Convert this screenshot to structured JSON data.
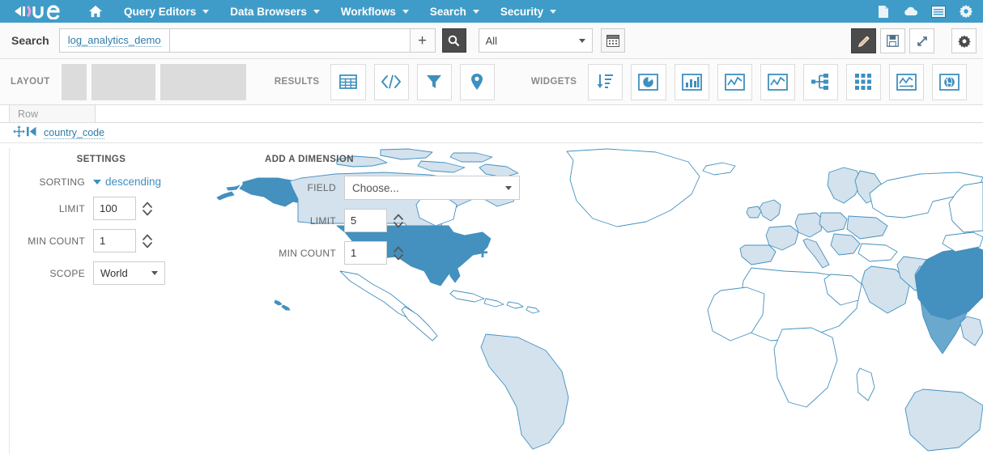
{
  "navbar": {
    "brand": "HUE",
    "home_icon": "home-icon",
    "items": [
      {
        "label": "Query Editors",
        "caret": true
      },
      {
        "label": "Data Browsers",
        "caret": true
      },
      {
        "label": "Workflows",
        "caret": true
      },
      {
        "label": "Search",
        "caret": true
      },
      {
        "label": "Security",
        "caret": true
      }
    ],
    "right_icons": [
      "document-icon",
      "cloud-icon",
      "list-icon",
      "gear-icon"
    ]
  },
  "search": {
    "label": "Search",
    "collection_chip": "log_analytics_demo",
    "query_value": "",
    "query_placeholder": "",
    "add_label": "+",
    "search_icon": "search-icon",
    "scope_select": "All",
    "calendar_icon": "calendar-icon",
    "toolbar_icons": [
      "edit-pencil-icon",
      "save-floppy-icon",
      "expand-arrows-icon",
      "settings-gear-icon"
    ]
  },
  "builder": {
    "layout_label": "LAYOUT",
    "results_label": "RESULTS",
    "widgets_label": "WIDGETS",
    "results_icons": [
      "grid-table-icon",
      "code-brackets-icon",
      "filter-funnel-icon",
      "map-marker-icon"
    ],
    "widget_icons": [
      "sort-descending-icon",
      "pie-chart-icon",
      "bar-chart-icon",
      "line-chart-icon",
      "tree-hierarchy-icon",
      "grid-squares-icon",
      "timeline-chart-icon",
      "globe-map-icon"
    ]
  },
  "row": {
    "tab_label": "Row",
    "move_icon": "move-arrows-icon",
    "step_icon": "step-backward-icon",
    "field_name": "country_code"
  },
  "settings": {
    "title": "SETTINGS",
    "sorting_label": "SORTING",
    "sorting_value": "descending",
    "limit_label": "LIMIT",
    "limit_value": "100",
    "min_count_label": "MIN COUNT",
    "min_count_value": "1",
    "scope_label": "SCOPE",
    "scope_value": "World"
  },
  "dimension": {
    "title": "ADD A DIMENSION",
    "field_label": "FIELD",
    "field_value": "Choose...",
    "limit_label": "LIMIT",
    "limit_value": "5",
    "min_count_label": "MIN COUNT",
    "min_count_value": "1",
    "add_label": "+"
  },
  "colors": {
    "navbar": "#3f9cc8",
    "accent": "#3f8fbf",
    "map_high": "#4490bf",
    "map_mid": "#6aa8ce",
    "map_low": "#d3e2ed",
    "map_stroke": "#4490bf",
    "toolbar_active": "#4b4b4b"
  },
  "chart_data": {
    "type": "heatmap",
    "title": "country_code",
    "projection": "world-equirectangular",
    "scope": "World",
    "legend_position": "none",
    "regions": [
      {
        "code": "US",
        "name": "United States",
        "level": "high",
        "color": "#4490bf"
      },
      {
        "code": "CN",
        "name": "China",
        "level": "high",
        "color": "#4490bf"
      },
      {
        "code": "IN",
        "name": "India",
        "level": "mid",
        "color": "#6aa8ce"
      },
      {
        "code": "CA",
        "name": "Canada",
        "level": "low",
        "color": "#d3e2ed"
      },
      {
        "code": "GB",
        "name": "United Kingdom",
        "level": "low",
        "color": "#d3e2ed"
      },
      {
        "code": "FR",
        "name": "France",
        "level": "low",
        "color": "#d3e2ed"
      },
      {
        "code": "DE",
        "name": "Germany",
        "level": "low",
        "color": "#d3e2ed"
      },
      {
        "code": "RU",
        "name": "Russia",
        "level": "none",
        "color": "#ffffff"
      },
      {
        "code": "BR",
        "name": "Brazil",
        "level": "low",
        "color": "#d3e2ed"
      },
      {
        "code": "AU",
        "name": "Australia",
        "level": "low",
        "color": "#d3e2ed"
      }
    ]
  }
}
